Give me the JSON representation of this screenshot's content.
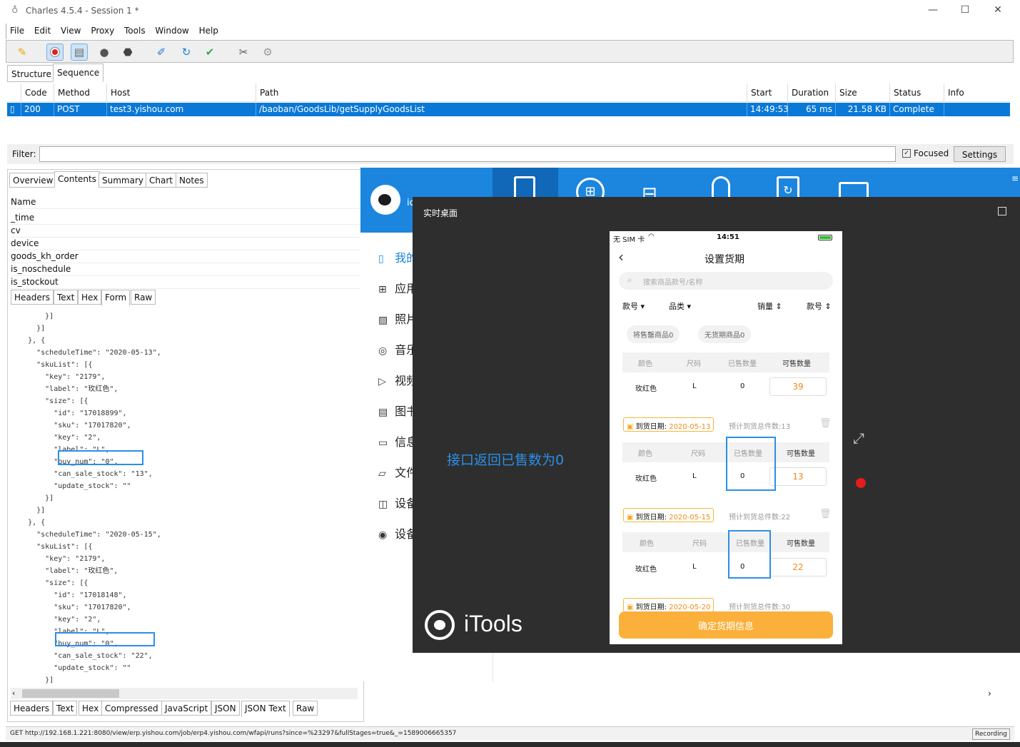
{
  "app": {
    "title": "Charles 4.5.4 - Session 1 *"
  },
  "menu": [
    "File",
    "Edit",
    "View",
    "Proxy",
    "Tools",
    "Window",
    "Help"
  ],
  "top_tabs": [
    "Structure",
    "Sequence"
  ],
  "grid": {
    "columns": [
      "Code",
      "Method",
      "Host",
      "Path",
      "Start",
      "Duration",
      "Size",
      "Status",
      "Info"
    ],
    "row": {
      "code": "200",
      "method": "POST",
      "host": "test3.yishou.com",
      "path": "/baoban/GoodsLib/getSupplyGoodsList",
      "start": "14:49:53",
      "duration": "65 ms",
      "size": "21.58 KB",
      "status": "Complete",
      "info": ""
    }
  },
  "filter": {
    "label": "Filter:",
    "value": "",
    "focused_label": "Focused",
    "settings_label": "Settings"
  },
  "detail_tabs": [
    "Overview",
    "Contents",
    "Summary",
    "Chart",
    "Notes"
  ],
  "params": {
    "header": "Name",
    "rows": [
      "_time",
      "cv",
      "device",
      "goods_kh_order",
      "is_noschedule",
      "is_stockout"
    ]
  },
  "request_tabs": [
    "Headers",
    "Text",
    "Hex",
    "Form",
    "Raw"
  ],
  "json_lines": [
    "        }]",
    "      }]",
    "    }, {",
    "      \"scheduleTime\": \"2020-05-13\",",
    "      \"skuList\": [{",
    "        \"key\": \"2179\",",
    "        \"label\": \"玫红色\",",
    "        \"size\": [{",
    "          \"id\": \"17018899\",",
    "          \"sku\": \"17017820\",",
    "          \"key\": \"2\",",
    "          \"label\": \"L\",",
    "          \"buy_num\": \"0\",",
    "          \"can_sale_stock\": \"13\",",
    "          \"update_stock\": \"\"",
    "        }]",
    "      }]",
    "    }, {",
    "      \"scheduleTime\": \"2020-05-15\",",
    "      \"skuList\": [{",
    "        \"key\": \"2179\",",
    "        \"label\": \"玫红色\",",
    "        \"size\": [{",
    "          \"id\": \"17018148\",",
    "          \"sku\": \"17017820\",",
    "          \"key\": \"2\",",
    "          \"label\": \"L\",",
    "          \"buy_num\": \"0\",",
    "          \"can_sale_stock\": \"22\",",
    "          \"update_stock\": \"\"",
    "        }]",
    "      }]"
  ],
  "response_tabs": [
    "Headers",
    "Text",
    "Hex",
    "Compressed",
    "JavaScript",
    "JSON",
    "JSON Text",
    "Raw"
  ],
  "status": {
    "url": "GET http://192.168.1.221:8080/view/erp.yishou.com/job/erp4.yishou.com/wfapi/runs?since=%23297&fullStages=true&_=1589006665357",
    "recording": "Recording"
  },
  "itools": {
    "brand_fragment": "ic",
    "nav": [
      "我的",
      "应用",
      "照片",
      "音乐",
      "视频",
      "图书",
      "信息",
      "文件",
      "设备",
      "设备"
    ],
    "window_title": "实时桌面",
    "annotation": "接口返回已售数为0",
    "logo": "iTools"
  },
  "phone": {
    "carrier": "无 SIM 卡",
    "time": "14:51",
    "title": "设置货期",
    "search_placeholder": "搜索商品款号/名称",
    "filters": [
      "款号",
      "品类",
      "销量",
      "款号"
    ],
    "chips": [
      "将售罄商品0",
      "无货期商品0"
    ],
    "table_headers": [
      "颜色",
      "尺码",
      "已售数量",
      "可售数量"
    ],
    "sections": [
      {
        "date_label": "",
        "date": "",
        "forecast": "",
        "color": "玫红色",
        "size": "L",
        "sold": "0",
        "avail": "39"
      },
      {
        "date_label": "到货日期:",
        "date": "2020-05-13",
        "forecast": "预计到货总件数:13",
        "color": "玫红色",
        "size": "L",
        "sold": "0",
        "avail": "13"
      },
      {
        "date_label": "到货日期:",
        "date": "2020-05-15",
        "forecast": "预计到货总件数:22",
        "color": "玫红色",
        "size": "L",
        "sold": "0",
        "avail": "22"
      },
      {
        "date_label": "到货日期:",
        "date": "2020-05-20",
        "forecast": "预计到货总件数:30"
      }
    ],
    "confirm_label": "确定货期信息"
  },
  "colors": {
    "selection": "#0a78d7",
    "itools_blue": "#1c86de",
    "highlight": "#2a8fe8",
    "orange": "#f08a1c",
    "confirm": "#fbb03b"
  }
}
